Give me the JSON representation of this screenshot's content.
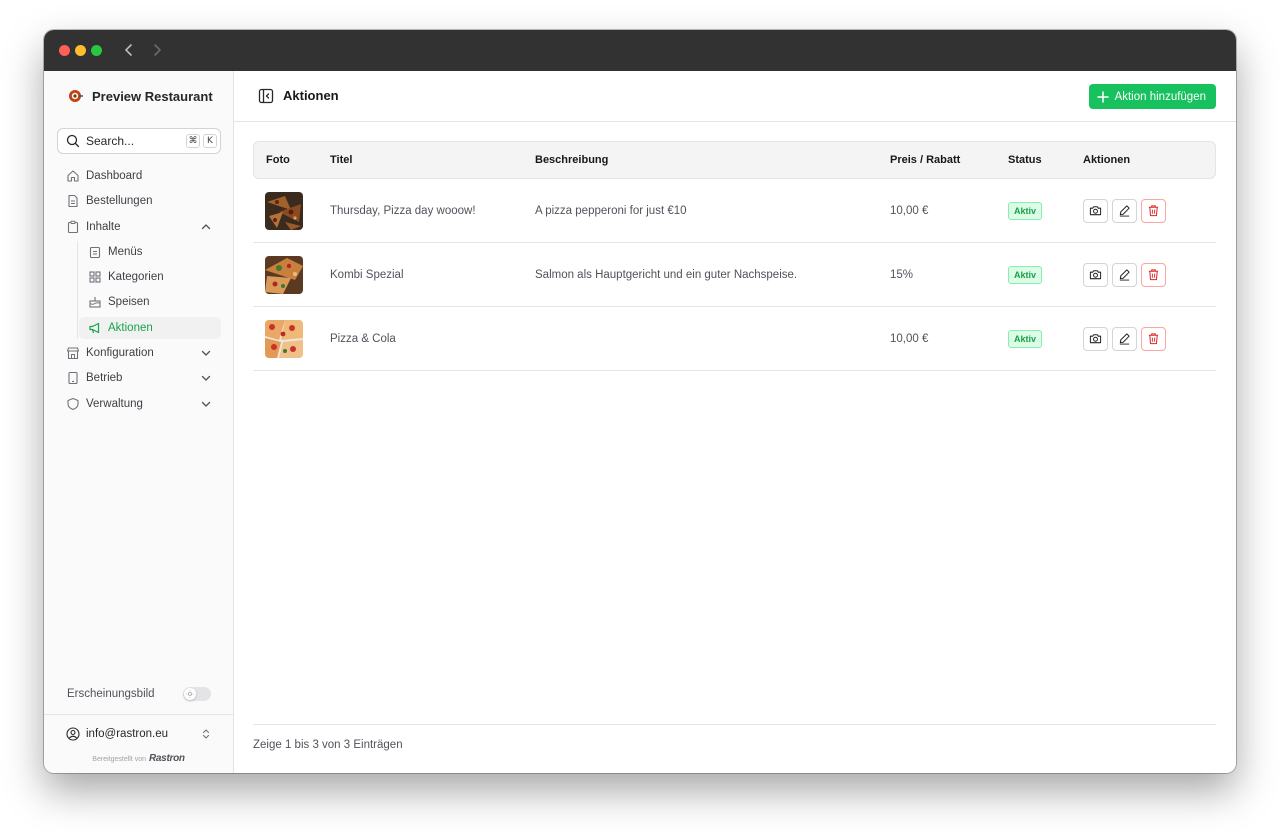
{
  "brand": {
    "name": "Preview Restaurant"
  },
  "search": {
    "placeholder": "Search...",
    "shortcut_cmd": "⌘",
    "shortcut_key": "K"
  },
  "sidebar": {
    "items": [
      {
        "label": "Dashboard"
      },
      {
        "label": "Bestellungen"
      },
      {
        "label": "Inhalte"
      },
      {
        "label": "Menüs"
      },
      {
        "label": "Kategorien"
      },
      {
        "label": "Speisen"
      },
      {
        "label": "Aktionen"
      },
      {
        "label": "Konfiguration"
      },
      {
        "label": "Betrieb"
      },
      {
        "label": "Verwaltung"
      }
    ],
    "appearance_label": "Erscheinungsbild",
    "account_email": "info@rastron.eu",
    "powered_by": "Bereitgestellt von",
    "powered_brand": "Rastron"
  },
  "header": {
    "title": "Aktionen",
    "add_button": "Aktion hinzufügen"
  },
  "table": {
    "columns": [
      "Foto",
      "Titel",
      "Beschreibung",
      "Preis / Rabatt",
      "Status",
      "Aktionen"
    ],
    "rows": [
      {
        "title": "Thursday, Pizza day wooow!",
        "description": "A pizza pepperoni for just €10",
        "price": "10,00 €",
        "status": "Aktiv"
      },
      {
        "title": "Kombi Spezial",
        "description": "Salmon als Hauptgericht und ein guter Nachspeise.",
        "price": "15%",
        "status": "Aktiv"
      },
      {
        "title": "Pizza & Cola",
        "description": "",
        "price": "10,00 €",
        "status": "Aktiv"
      }
    ],
    "footer": "Zeige 1 bis 3 von 3 Einträgen"
  },
  "colors": {
    "accent": "#16c15e",
    "active_nav": "#16a34a",
    "danger": "#dc2626"
  }
}
